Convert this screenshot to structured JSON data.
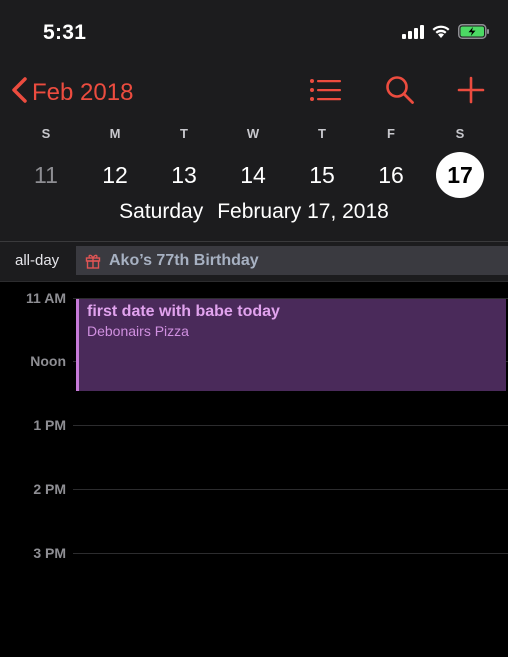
{
  "status_bar": {
    "time": "5:31"
  },
  "nav": {
    "back_label": "Feb 2018",
    "accent_color": "#ec4c3f"
  },
  "week": {
    "weekdays": [
      "S",
      "M",
      "T",
      "W",
      "T",
      "F",
      "S"
    ],
    "days": [
      "11",
      "12",
      "13",
      "14",
      "15",
      "16",
      "17"
    ],
    "selected_day": "17"
  },
  "selected_date": {
    "weekday": "Saturday",
    "date": "February 17, 2018"
  },
  "all_day": {
    "label": "all-day",
    "event_title": "Ako’s 77th Birthday",
    "event_icon": "gift-icon"
  },
  "timeline": {
    "hours": [
      "11 AM",
      "Noon",
      "1 PM",
      "2 PM",
      "3 PM"
    ]
  },
  "event": {
    "title": "first date with babe today",
    "location": "Debonairs Pizza",
    "color": "#c77ad8"
  }
}
